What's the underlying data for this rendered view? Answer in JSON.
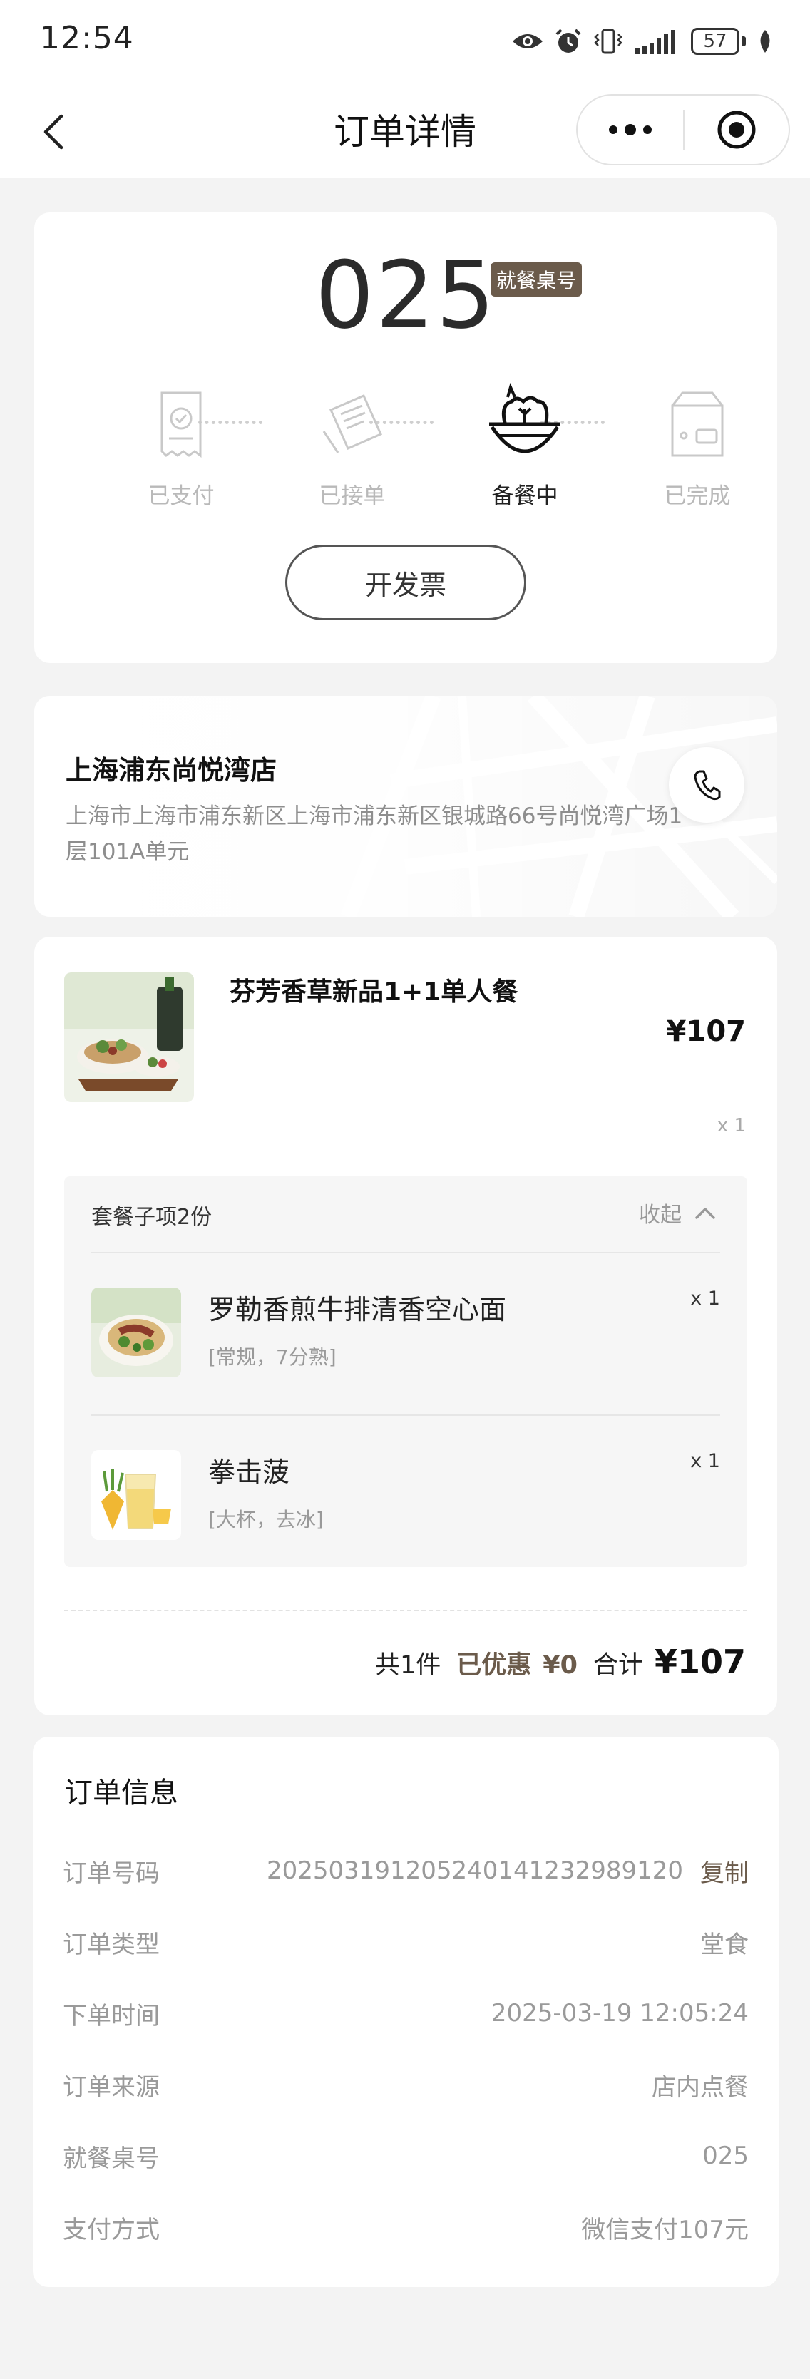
{
  "status_bar": {
    "time": "12:54",
    "battery": "57"
  },
  "nav": {
    "title": "订单详情"
  },
  "status_card": {
    "table_number": "025",
    "table_badge": "就餐桌号",
    "steps": [
      {
        "label": "已支付",
        "icon": "receipt-check-icon",
        "active": false
      },
      {
        "label": "已接单",
        "icon": "order-ticket-icon",
        "active": false
      },
      {
        "label": "备餐中",
        "icon": "salad-bowl-icon",
        "active": true
      },
      {
        "label": "已完成",
        "icon": "takeout-bag-icon",
        "active": false
      }
    ],
    "invoice_label": "开发票"
  },
  "store": {
    "name": "上海浦东尚悦湾店",
    "address": "上海市上海市浦东新区上海市浦东新区银城路66号尚悦湾广场1层101A单元"
  },
  "product": {
    "name": "芬芳香草新品1+1单人餐",
    "price": "¥107",
    "qty": "x 1",
    "combo_label": "套餐子项2份",
    "collapse_label": "收起",
    "sub_items": [
      {
        "name": "罗勒香煎牛排清香空心面",
        "spec": "[常规，7分熟]",
        "qty": "x 1"
      },
      {
        "name": "拳击菠",
        "spec": "[大杯，去冰]",
        "qty": "x 1"
      }
    ]
  },
  "summary": {
    "count": "共1件",
    "discount_label": "已优惠",
    "discount": "¥0",
    "total_label": "合计",
    "total": "¥107"
  },
  "order_info": {
    "title": "订单信息",
    "copy_label": "复制",
    "rows": [
      {
        "label": "订单号码",
        "value": "20250319120524014123298912​0"
      },
      {
        "label": "订单类型",
        "value": "堂食"
      },
      {
        "label": "下单时间",
        "value": "2025-03-19 12:05:24"
      },
      {
        "label": "订单来源",
        "value": "店内点餐"
      },
      {
        "label": "就餐桌号",
        "value": "025"
      },
      {
        "label": "支付方式",
        "value": "微信支付107元"
      }
    ]
  },
  "colors": {
    "accent_brown": "#6b5b4b",
    "background": "#f3f3f3"
  }
}
